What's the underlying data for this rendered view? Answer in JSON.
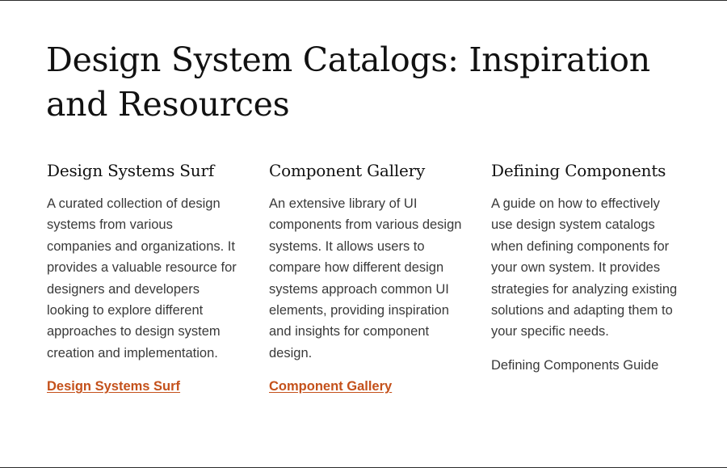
{
  "page": {
    "title": "Design System Catalogs: Inspiration and Resources"
  },
  "columns": [
    {
      "title": "Design Systems Surf",
      "description": "A curated collection of design systems from various companies and organizations. It provides a valuable resource for designers and developers looking to explore different approaches to design system creation and implementation.",
      "link_label": "Design Systems Surf"
    },
    {
      "title": "Component Gallery",
      "description": "An extensive library of UI components from various design systems. It allows users to compare how different design systems approach common UI elements, providing inspiration and insights for component design.",
      "link_label": "Component Gallery"
    },
    {
      "title": "Defining Components",
      "description": "A guide on how to effectively use design system catalogs when defining components for your own system. It provides strategies for analyzing existing solutions and adapting them to your specific needs.",
      "link_label": "Defining Components Guide"
    }
  ],
  "colors": {
    "link": "#c4511b",
    "heading": "#111111",
    "body_text": "#3a3a3a",
    "background": "#ffffff"
  }
}
